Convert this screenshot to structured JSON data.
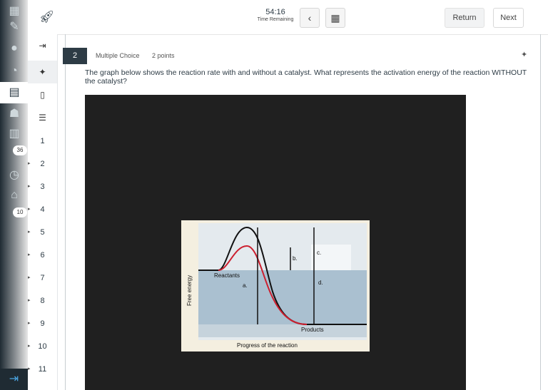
{
  "topbar": {
    "timer": "54:16",
    "timer_label": "Time Remaining",
    "return_label": "Return",
    "next_label": "Next"
  },
  "global_nav": {
    "badge_inbox": "36",
    "badge_history": "10"
  },
  "question_nav": {
    "numbers": [
      "1",
      "2",
      "3",
      "4",
      "5",
      "6",
      "7",
      "8",
      "9",
      "10",
      "11"
    ]
  },
  "question": {
    "number": "2",
    "type": "Multiple Choice",
    "points": "2 points",
    "text": "The graph below shows the reaction rate with and without a catalyst. What represents the activation energy of the reaction WITHOUT the catalyst?"
  },
  "figure": {
    "ylabel": "Free energy",
    "xlabel": "Progress of the reaction",
    "reactants": "Reactants",
    "products": "Products",
    "label_a": "a.",
    "label_b": "b.",
    "label_c": "c.",
    "label_d": "d."
  }
}
